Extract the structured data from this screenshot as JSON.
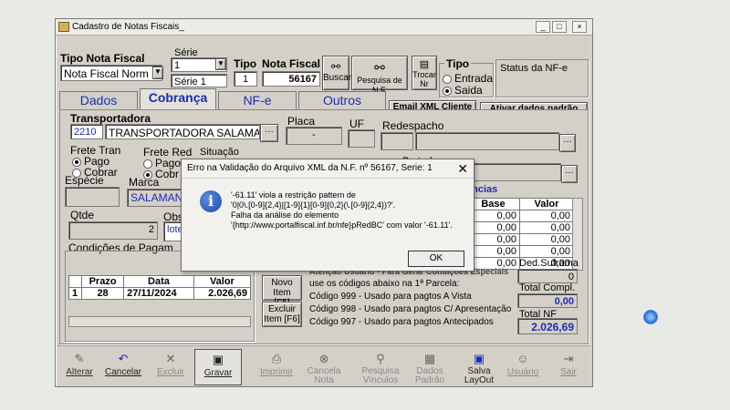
{
  "window": {
    "title": "Cadastro de Notas Fiscais_"
  },
  "header": {
    "tipo_nota_label": "Tipo Nota Fiscal",
    "tipo_nota_value": "Nota Fiscal Norm",
    "serie_label": "Série",
    "serie_value": "1",
    "serie_desc": "Série 1",
    "tipo_label": "Tipo",
    "tipo_value": "1",
    "nota_fiscal_label": "Nota Fiscal",
    "nota_fiscal_value": "56167",
    "buscar_label": "Buscar",
    "pesquisa_label": "Pesquisa de N.F.",
    "trocar_label": "Trocar",
    "trocar_sub": "Nr",
    "tipo_group_label": "Tipo",
    "entrada_label": "Entrada",
    "saida_label": "Saida",
    "status_label": "Status da NF-e"
  },
  "tabs": [
    {
      "label": "Dados"
    },
    {
      "label": "Cobrança"
    },
    {
      "label": "NF-e"
    },
    {
      "label": "Outros"
    }
  ],
  "actions": {
    "email_xml": "Email XML Cliente",
    "ativar": "Ativar dados padrão"
  },
  "transport": {
    "transportadora_label": "Transportadora",
    "code": "2210",
    "name": "TRANSPORTADORA SALAMA",
    "placa_label": "Placa",
    "placa_value": "-",
    "uf_label": "UF",
    "redespacho_label": "Redespacho",
    "frete_tran_label": "Frete Tran",
    "frete_red_label": "Frete Red",
    "situacao_label": "Situação",
    "pago_label": "Pago",
    "cobrar_label": "Cobrar",
    "cobr_label": "Cobr",
    "pago2_label": "Pago",
    "portador_label": "Portador",
    "especie_label": "Espécie",
    "marca_label": "Marca",
    "marca_value": "SALAMAN",
    "qtde_label": "Qtde",
    "qtde_value": "2",
    "obs_label": "Obs",
    "obs_value": "lote",
    "ancias_label": "ências"
  },
  "values_table": {
    "headers": [
      "Base",
      "Valor"
    ],
    "rows": [
      [
        "0,00",
        "0,00"
      ],
      [
        "0,00",
        "0,00"
      ],
      [
        "0,00",
        "0,00"
      ],
      [
        "0,00",
        "0,00"
      ],
      [
        "0,00",
        "0,00"
      ]
    ]
  },
  "conditions": {
    "label": "Condições de Pagam",
    "headers": [
      "Prazo",
      "Data",
      "Valor"
    ],
    "rows": [
      {
        "n": "1",
        "prazo": "28",
        "data": "27/11/2024",
        "valor": "2.026,69"
      }
    ],
    "novo_item": "Novo Item",
    "novo_key": "[F5]",
    "excluir_item": "Excluir",
    "excluir_item2": "Item [F6]"
  },
  "notes": {
    "line0": "Atenção Usuário - Para Gerar Condições Especiais",
    "line1": "use os códigos abaixo na 1ª Parcela:",
    "line2": "Código 999 - Usado para pagtos A Vista",
    "line3": "Código 998 - Usado para pagtos C/ Apresentação",
    "line4": "Código 997 - Usado para pagtos Antecipados"
  },
  "totals": {
    "ded_label": "Ded.Suframa",
    "ded_value": "0",
    "compl_label": "Total Compl.",
    "compl_value": "0,00",
    "nf_label": "Total NF",
    "nf_value": "2.026,69"
  },
  "toolbar": [
    {
      "label": "Alterar",
      "icon": "edit-icon"
    },
    {
      "label": "Cancelar",
      "icon": "undo-icon"
    },
    {
      "label": "Excluir",
      "icon": "x-icon"
    },
    {
      "label": "Gravar",
      "icon": "floppy-icon"
    },
    {
      "label": "Imprimir",
      "icon": "printer-icon"
    },
    {
      "label": "Cancela",
      "label2": "Nota",
      "icon": "cancel-circle-icon"
    },
    {
      "label": "Pesquisa",
      "label2": "Vínculos",
      "icon": "search-icon"
    },
    {
      "label": "Dados",
      "label2": "Padrão",
      "icon": "data-icon"
    },
    {
      "label": "Salva",
      "label2": "LayOut",
      "icon": "save-layout-icon"
    },
    {
      "label": "Usuário",
      "icon": "user-icon"
    },
    {
      "label": "Sair",
      "icon": "exit-icon"
    }
  ],
  "dialog": {
    "title": "Erro na Validação do Arquivo XML da N.F. nº 56167, Serie: 1",
    "msg1": "'-61.11' viola a restrição pattern de",
    "msg2": "'0|0\\.[0-9]{2,4}|[1-9]{1}[0-9]{0,2}(\\.[0-9]{2,4})?'.",
    "msg3": "Falha da análise do elemento",
    "msg4": "'{http://www.portalfiscal.inf.br/nfe}pRedBC' com valor '-61.11'.",
    "ok_label": "OK"
  }
}
